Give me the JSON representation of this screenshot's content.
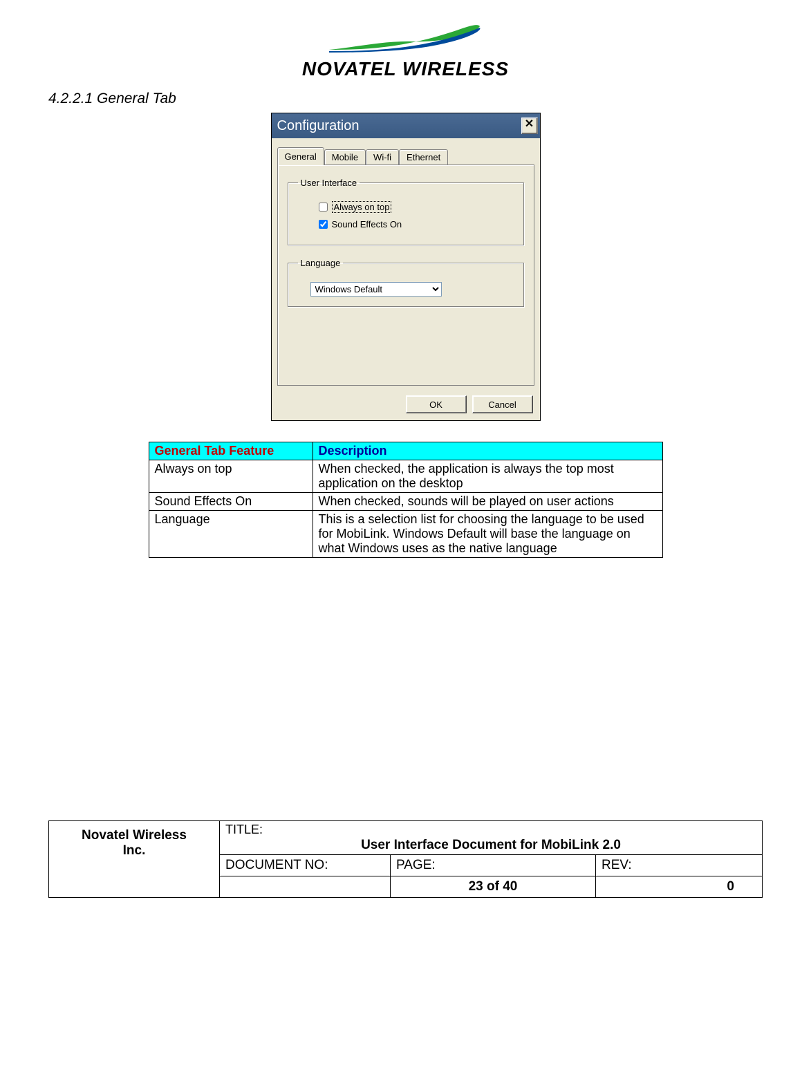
{
  "logo": {
    "brand_text": "NOVATEL WIRELESS"
  },
  "section_heading": "4.2.2.1   General Tab",
  "dialog": {
    "title": "Configuration",
    "close_glyph": "✕",
    "tabs": {
      "general": "General",
      "mobile": "Mobile",
      "wifi": "Wi-fi",
      "ethernet": "Ethernet"
    },
    "groups": {
      "user_interface": {
        "legend": "User Interface",
        "always_on_top_label": "Always on top",
        "sound_effects_label": "Sound Effects On"
      },
      "language": {
        "legend": "Language",
        "selected": "Windows Default"
      }
    },
    "buttons": {
      "ok": "OK",
      "cancel": "Cancel"
    }
  },
  "feature_table": {
    "headers": {
      "feature": "General Tab Feature",
      "description": "Description"
    },
    "rows": [
      {
        "feature": "Always on top",
        "description": "When checked, the application is always the top most application on the desktop"
      },
      {
        "feature": "Sound Effects On",
        "description": "When checked, sounds will be played on user actions"
      },
      {
        "feature": "Language",
        "description": "This is a selection list for choosing the language to be used for MobiLink.  Windows Default will base the language on what Windows uses as the native language"
      }
    ]
  },
  "doc_footer": {
    "company_line1": "Novatel Wireless",
    "company_line2": "Inc.",
    "title_label": "TITLE:",
    "title_value": "User Interface Document for MobiLink 2.0",
    "doc_no_label": "DOCUMENT NO:",
    "page_label": "PAGE:",
    "page_value": "23 of 40",
    "rev_label": "REV:",
    "rev_value": "0"
  }
}
